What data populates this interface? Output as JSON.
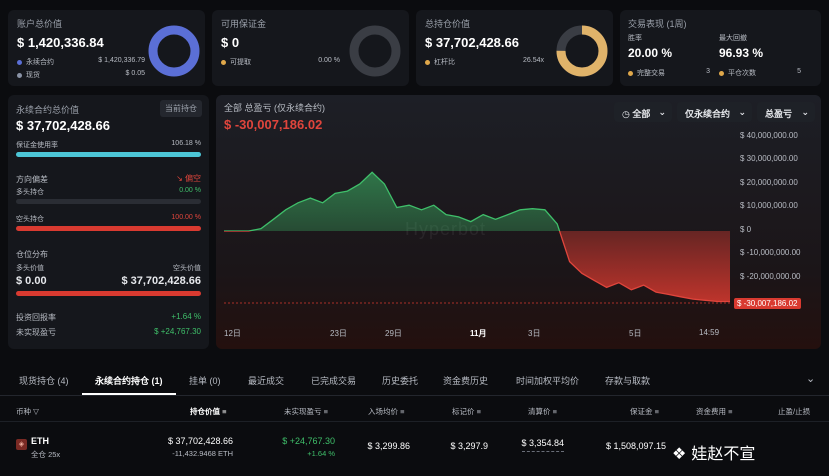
{
  "cards": {
    "account": {
      "title": "账户总价值",
      "value": "$ 1,420,336.84",
      "rows": [
        {
          "label": "永续合约",
          "value": "$ 1,420,336.79",
          "color": "#5b6fd6"
        },
        {
          "label": "现货",
          "value": "$ 0.05",
          "color": "#8a93a6"
        }
      ]
    },
    "margin": {
      "title": "可用保证金",
      "value": "$ 0",
      "rows": [
        {
          "label": "可提取",
          "value": "0.00 %",
          "color": "#e0a84a"
        }
      ]
    },
    "position": {
      "title": "总持仓价值",
      "value": "$ 37,702,428.66",
      "rows": [
        {
          "label": "杠杆比",
          "value": "26.54x",
          "color": "#e0a84a"
        }
      ]
    },
    "performance": {
      "title": "交易表现 (1周)",
      "win_rate_label": "胜率",
      "win_rate": "20.00 %",
      "drawdown_label": "最大回撤",
      "drawdown": "96.93 %",
      "rows": [
        {
          "label": "完整交易",
          "value": "3",
          "color": "#e0a84a"
        },
        {
          "label": "平仓次数",
          "value": "5",
          "color": "#e0a84a"
        }
      ]
    }
  },
  "perp_panel": {
    "title": "永续合约总价值",
    "badge": "当前持仓",
    "value": "$ 37,702,428.66",
    "margin_usage_label": "保证金使用率",
    "margin_usage_value": "106.18 %",
    "margin_usage_fraction": 1.0,
    "bias_label": "方向偏差",
    "bias_value": "偏空",
    "long_label": "多头持仓",
    "long_value": "0.00 %",
    "long_fraction": 0.0,
    "short_label": "空头持仓",
    "short_value": "100.00 %",
    "short_fraction": 1.0,
    "dist_title": "仓位分布",
    "dist_long_label": "多头价值",
    "dist_short_label": "空头价值",
    "dist_long_value": "$ 0.00",
    "dist_short_value": "$ 37,702,428.66",
    "roi_label": "投资回报率",
    "roi_value": "+1.64 %",
    "upnl_label": "未实现盈亏",
    "upnl_value": "$ +24,767.30"
  },
  "pnl_chart": {
    "title": "全部 总盈亏 (仅永续合约)",
    "value": "$ -30,007,186.02",
    "filter_all": "全部",
    "filter_perp": "仅永续合约",
    "filter_pnl": "总盈亏",
    "watermark": "Hyperbot",
    "current_label": "$ -30,007,186.02"
  },
  "chart_data": {
    "type": "area",
    "title": "全部 总盈亏 (仅永续合约)",
    "y_ticks": [
      "$ 40,000,000.00",
      "$ 30,000,000.00",
      "$ 20,000,000.00",
      "$ 10,000,000.00",
      "$ 0",
      "$ -10,000,000.00",
      "$ -20,000,000.00"
    ],
    "x_ticks": [
      "12日",
      "23日",
      "29日",
      "11月",
      "3日",
      "5日",
      "14:59"
    ],
    "ylim": [
      -34000000,
      44000000
    ],
    "positive_color": "#3fbf6a",
    "negative_color": "#e0453c",
    "values": [
      0,
      0,
      0,
      1000000,
      5000000,
      9000000,
      12000000,
      14000000,
      12000000,
      16000000,
      17000000,
      20000000,
      25000000,
      20000000,
      10000000,
      11000000,
      9000000,
      11000000,
      7000000,
      6000000,
      4000000,
      7000000,
      5000000,
      7000000,
      9000000,
      9500000,
      9000000,
      3000000,
      -13000000,
      -18000000,
      -21000000,
      -24000000,
      -22000000,
      -25000000,
      -23000000,
      -26000000,
      -27000000,
      -28000000,
      -29000000,
      -29500000,
      -30000000,
      -30007186
    ]
  },
  "bottom_tabs": [
    "现货持仓 (4)",
    "永续合约持仓 (1)",
    "挂单 (0)",
    "最近成交",
    "已完成交易",
    "历史委托",
    "资金费历史",
    "时间加权平均价",
    "存款与取款"
  ],
  "table": {
    "headers": [
      "币种",
      "持仓价值",
      "未实现盈亏",
      "入场均价",
      "标记价",
      "清算价",
      "保证金",
      "资金费用",
      "止盈/止损"
    ],
    "row": {
      "coin": "ETH",
      "mode": "全仓 25x",
      "value": "$ 37,702,428.66",
      "size": "-11,432.9468 ETH",
      "upnl": "$ +24,767.30",
      "upnl_pct": "+1.64 %",
      "entry": "$ 3,299.86",
      "mark": "$ 3,297.9",
      "liq": "$ 3,354.84",
      "margin": "$ 1,508,097.15"
    }
  },
  "watermark_text": "娃赵不宣"
}
